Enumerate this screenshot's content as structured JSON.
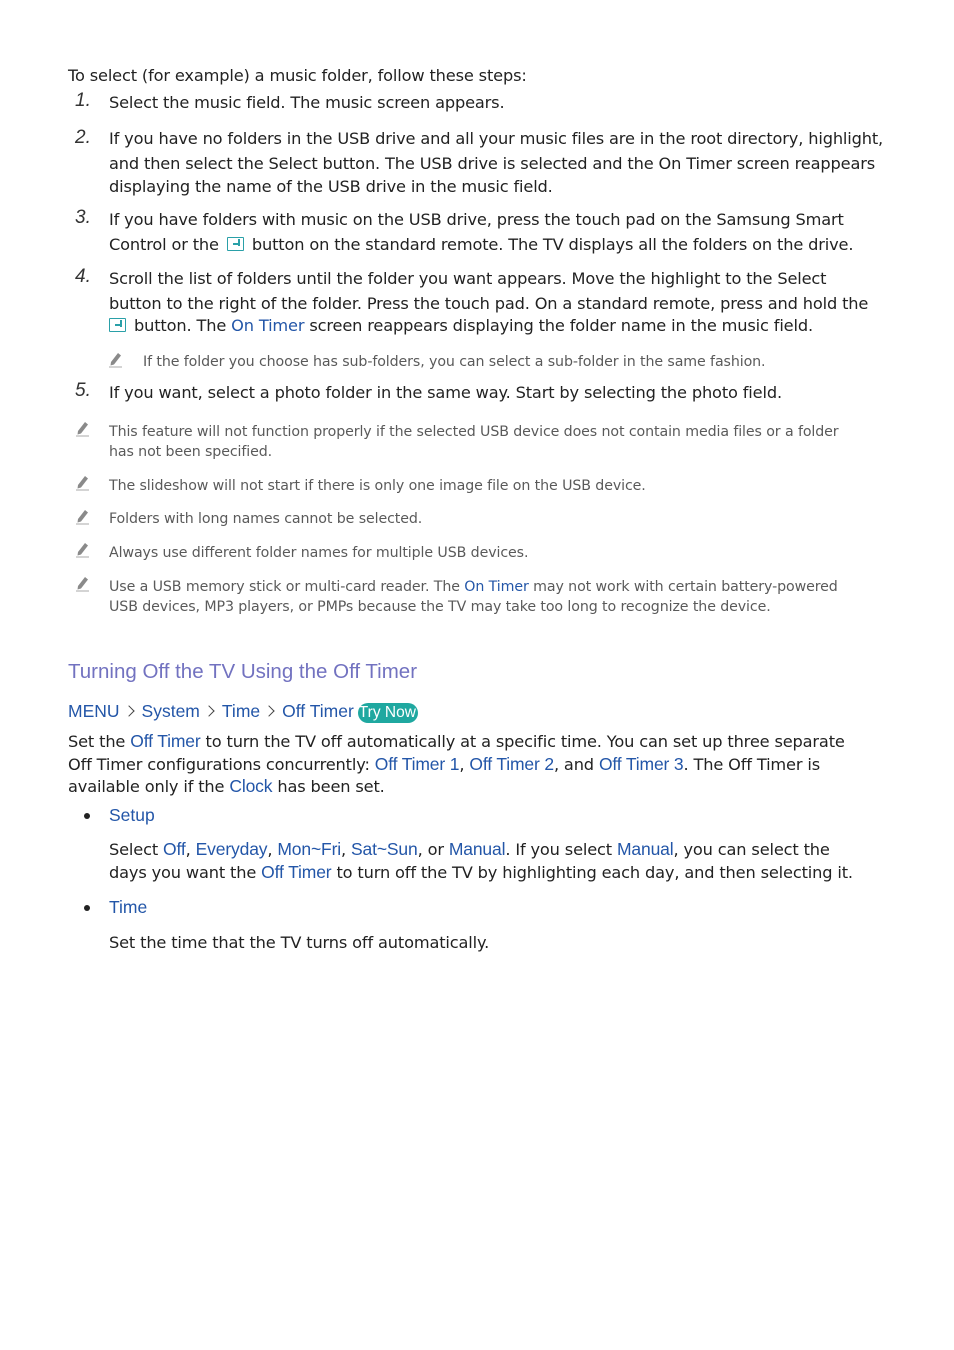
{
  "intro": "To select (for example) a music folder, follow these steps:",
  "steps": [
    {
      "num": "1.",
      "lines": [
        "Select the music field. The music screen appears."
      ]
    },
    {
      "num": "2.",
      "lines": [
        "If you have no folders in the USB drive and all your music files are in the root directory, highlight,",
        "and then select the Select button. The USB drive is selected and the On Timer screen reappears",
        "displaying the name of the USB drive in the music field."
      ]
    },
    {
      "num": "3.",
      "line1": "If you have folders with music on the USB drive, press the touch pad on the Samsung Smart",
      "line2_pre": "Control or the",
      "line2_post": "button on the standard remote. The TV displays all the folders on the drive."
    },
    {
      "num": "4.",
      "line1": "Scroll the list of folders until the folder you want appears. Move the highlight to the Select",
      "line2": "button to the right of the folder. Press the touch pad. On a standard remote, press and hold the",
      "line3_pre": "button. The",
      "line3_kw": "On Timer",
      "line3_post": "screen reappears displaying the folder name in the music field."
    },
    {
      "num": "5.",
      "lines": [
        "If you want, select a photo folder in the same way. Start by selecting the photo field."
      ]
    }
  ],
  "step4_note": "If the folder you choose has sub-folders, you can select a sub-folder in the same fashion.",
  "notes": [
    {
      "lines": [
        "This feature will not function properly if the selected USB device does not contain media files or a folder",
        "has not been specified."
      ]
    },
    {
      "lines": [
        "The slideshow will not start if there is only one image file on the USB device."
      ]
    },
    {
      "lines": [
        "Folders with long names cannot be selected."
      ]
    },
    {
      "lines": [
        "Always use different folder names for multiple USB devices."
      ]
    },
    {
      "line1_pre": "Use a USB memory stick or multi-card reader. The",
      "line1_kw": "On Timer",
      "line1_post": "may not work with certain battery-powered",
      "line2": "USB devices, MP3 players, or PMPs because the TV may take too long to recognize the device."
    }
  ],
  "section": {
    "title": "Turning Off the TV Using the Off Timer",
    "breadcrumb": [
      "MENU",
      "System",
      "Time",
      "Off Timer"
    ],
    "try_now": "Try Now",
    "para": {
      "l1_a": "Set the",
      "l1_kw": "Off Timer",
      "l1_b": "to turn the TV off automatically at a specific time. You can set up three separate",
      "l2_a": "Off Timer configurations concurrently:",
      "l2_kw1": "Off Timer 1",
      "l2_sep1": ",",
      "l2_kw2": "Off Timer 2",
      "l2_sep2": ", and",
      "l2_kw3": "Off Timer 3",
      "l2_b": ". The Off Timer is",
      "l3_a": "available only if the",
      "l3_kw": "Clock",
      "l3_b": "has been set."
    },
    "items": [
      {
        "label": "Setup",
        "l1_a": "Select",
        "opt1": "Off",
        "opt2": "Everyday",
        "opt3": "Mon~Fri",
        "opt4": "Sat~Sun",
        "or": ", or",
        "opt5": "Manual",
        "l1_b": ". If you select",
        "opt6": "Manual",
        "l1_c": ", you can select the",
        "l2_a": "days you want the",
        "l2_kw": "Off Timer",
        "l2_b": "to turn off the TV by highlighting each day, and then selecting it."
      },
      {
        "label": "Time",
        "text": "Set the time that the TV turns off automatically."
      }
    ]
  },
  "colors": {
    "keyword": "#2356a8",
    "heading": "#7272c0",
    "try_now_bg": "#1fa8a0",
    "note": "#5a5a5a"
  }
}
